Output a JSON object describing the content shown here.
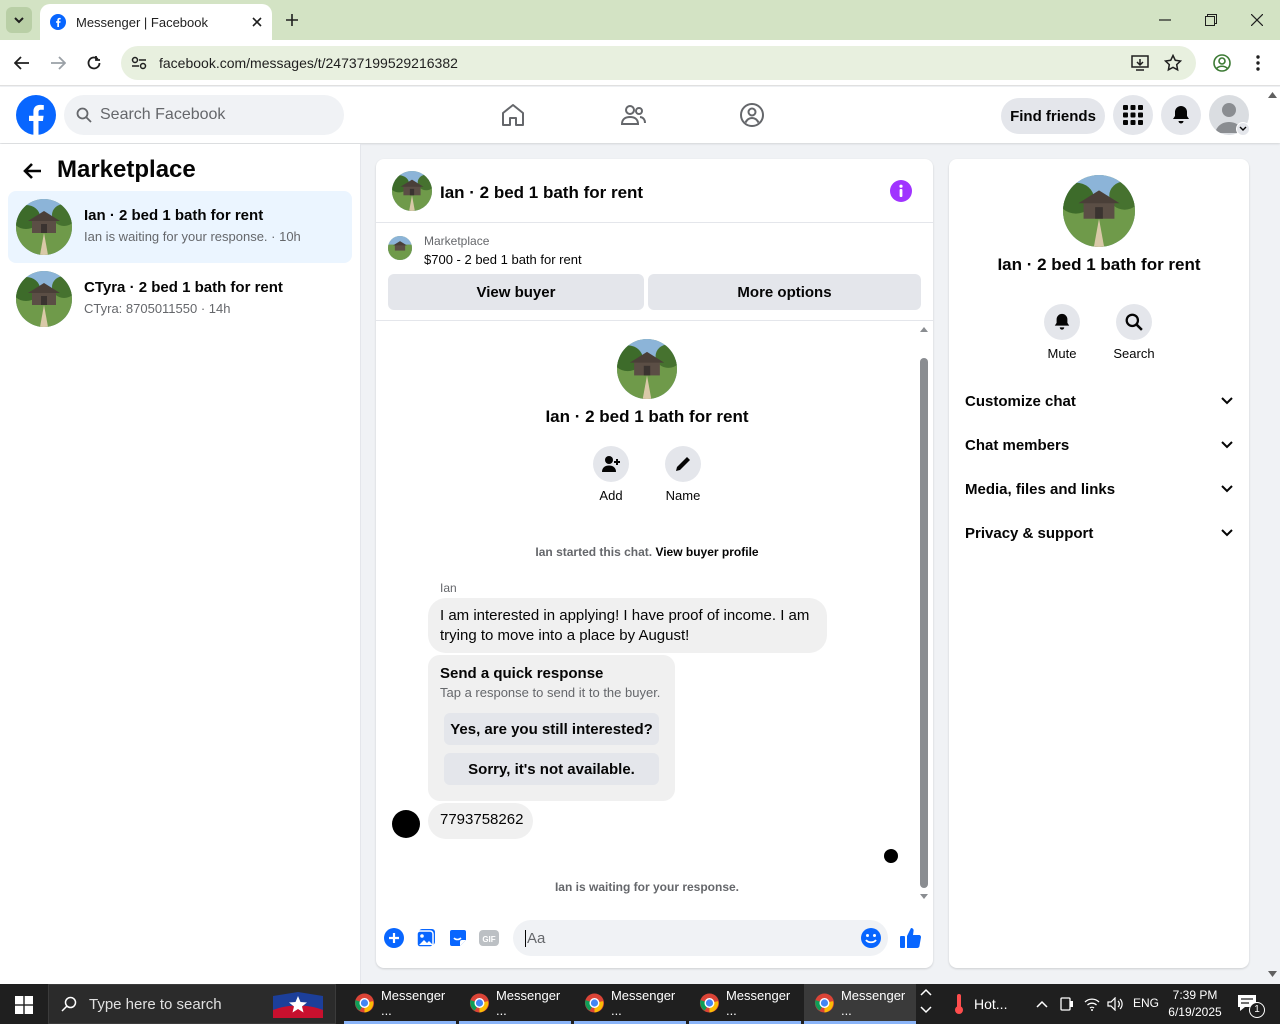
{
  "browser": {
    "tab_title": "Messenger | Facebook",
    "url": "facebook.com/messages/t/24737199529216382"
  },
  "header": {
    "search_placeholder": "Search Facebook",
    "find_friends_label": "Find friends"
  },
  "sidebar": {
    "title": "Marketplace",
    "conversations": [
      {
        "title": "Ian · 2 bed 1 bath for rent",
        "preview": "Ian is waiting for your response. · 10h",
        "selected": true
      },
      {
        "title": "CTyra · 2 bed 1 bath for rent",
        "preview": "CTyra: 8705011550 · 14h",
        "selected": false
      }
    ]
  },
  "chat": {
    "title": "Ian · 2 bed 1 bath for rent",
    "listing_source": "Marketplace",
    "listing_detail": "$700 - 2 bed 1 bath for rent",
    "view_buyer_label": "View buyer",
    "more_options_label": "More options",
    "intro_name": "Ian · 2 bed 1 bath for rent",
    "add_label": "Add",
    "name_label": "Name",
    "started_text": "Ian started this chat.",
    "view_profile_link": "View buyer profile",
    "sender_name": "Ian",
    "message_1": "I am interested in applying! I have proof of income. I am trying  to move into a place by August!",
    "quick_title": "Send a quick response",
    "quick_subtitle": "Tap a response to send it to the buyer.",
    "quick_option_1": "Yes, are you still interested?",
    "quick_option_2": "Sorry, it's not available.",
    "message_2": "7793758262",
    "waiting_text": "Ian is waiting for your response.",
    "composer_placeholder": "Aa"
  },
  "info_panel": {
    "name": "Ian · 2 bed 1 bath for rent",
    "mute_label": "Mute",
    "search_label": "Search",
    "sections": [
      "Customize chat",
      "Chat members",
      "Media, files and links",
      "Privacy & support"
    ]
  },
  "taskbar": {
    "search_placeholder": "Type here to search",
    "apps": [
      "Messenger ...",
      "Messenger ...",
      "Messenger ...",
      "Messenger ...",
      "Messenger ..."
    ],
    "weather": "Hot...",
    "language": "ENG",
    "time": "7:39 PM",
    "date": "6/19/2025",
    "notification_count": "1"
  },
  "colors": {
    "fb_blue": "#0866ff",
    "info_purple": "#a033ff",
    "chrome_green": "#d3e3c4"
  }
}
